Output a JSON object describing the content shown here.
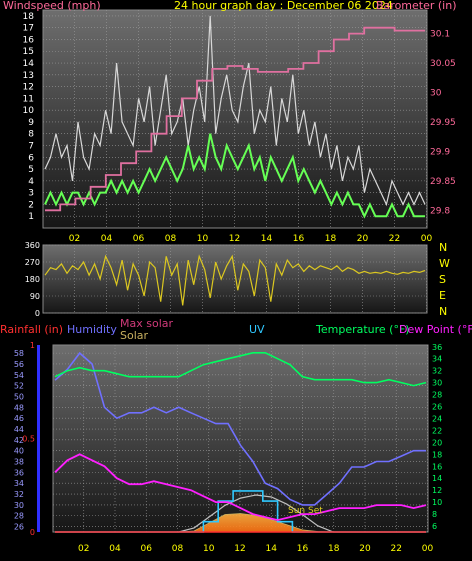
{
  "colors": {
    "background": "#000000",
    "panel_top": "#707070",
    "panel_bottom": "#1a1a1a",
    "axis_text": "#ffff00",
    "title_pink": "#ff6a9a",
    "wind_gust": "#d8d8d8",
    "wind_avg": "#66ff55",
    "barometer": "#e070a0",
    "wind_dir": "#dcc820",
    "rain": "#ff3030",
    "humidity": "#7070ff",
    "solar_max": "#d03a7a",
    "solar": "#c8b060",
    "uv": "#30c8ff",
    "temperature": "#00ff60",
    "dewpoint": "#ff20ff",
    "sun_arc": "#c0c0c0",
    "sunset_text": "#e0d020"
  },
  "top_panel": {
    "left_label": "Windspeed (mph)",
    "title": "24 hour graph day : December 06 2024",
    "right_label": "Barometer (in)"
  },
  "mid_panel": {
    "compass_labels": [
      "N",
      "W",
      "S",
      "E",
      "N"
    ]
  },
  "bottom_panel": {
    "rain_label": "Rainfall (in)",
    "humidity_label": "Humidity",
    "max_solar_label": "Max solar",
    "solar_label": "Solar",
    "uv_label": "UV",
    "temp_label": "Temperature (°F)",
    "dew_label": "Dew Point (°F)",
    "sunset_text": "Sun Set"
  },
  "chart_data": [
    {
      "type": "line",
      "x_tick_labels": [
        "02",
        "04",
        "06",
        "08",
        "10",
        "12",
        "14",
        "16",
        "18",
        "20",
        "22",
        "00"
      ],
      "y_left_ticks": [
        1,
        2,
        3,
        4,
        5,
        6,
        7,
        8,
        9,
        10,
        11,
        12,
        13,
        14,
        15,
        16,
        17,
        18
      ],
      "y_left_range": [
        0,
        18.5
      ],
      "y_right_ticks": [
        "29.8",
        "29.85",
        "29.9",
        "29.95",
        "30",
        "30.05",
        "30.1"
      ],
      "y_right_range": [
        29.77,
        30.14
      ],
      "grid": true,
      "series": [
        {
          "name": "Windspeed (mph)",
          "role": "gust",
          "axis": "left",
          "values": [
            5,
            6,
            8,
            6,
            7,
            4,
            9,
            6,
            5,
            8,
            7,
            10,
            8,
            14,
            9,
            8,
            7,
            11,
            9,
            12,
            7,
            10,
            13,
            8,
            9,
            11,
            7,
            10,
            12,
            9,
            18,
            8,
            11,
            13,
            10,
            9,
            12,
            14,
            8,
            10,
            9,
            12,
            7,
            11,
            9,
            13,
            8,
            10,
            7,
            9,
            6,
            8,
            5,
            7,
            4,
            6,
            5,
            7,
            3,
            5,
            4,
            3,
            2,
            4,
            3,
            2,
            3,
            2,
            3,
            2
          ]
        },
        {
          "name": "Windspeed (mph)",
          "role": "average",
          "axis": "left",
          "values": [
            2,
            3,
            2,
            3,
            2,
            3,
            3,
            2,
            3,
            2,
            3,
            3,
            4,
            3,
            4,
            3,
            4,
            3,
            4,
            5,
            4,
            5,
            6,
            5,
            4,
            5,
            7,
            5,
            6,
            5,
            8,
            6,
            5,
            7,
            6,
            5,
            6,
            7,
            5,
            6,
            4,
            6,
            5,
            4,
            5,
            6,
            4,
            5,
            4,
            3,
            4,
            3,
            2,
            3,
            2,
            3,
            2,
            2,
            1,
            2,
            1,
            1,
            1,
            2,
            1,
            1,
            2,
            1,
            1,
            1
          ]
        },
        {
          "name": "Barometer (in)",
          "axis": "right",
          "values": [
            29.8,
            29.81,
            29.82,
            29.84,
            29.86,
            29.88,
            29.9,
            29.93,
            29.96,
            29.99,
            30.02,
            30.04,
            30.045,
            30.04,
            30.035,
            30.035,
            30.04,
            30.05,
            30.07,
            30.09,
            30.1,
            30.11,
            30.11,
            30.105,
            30.105
          ]
        }
      ]
    },
    {
      "type": "line",
      "x_tick_labels": [
        "02",
        "04",
        "06",
        "08",
        "10",
        "12",
        "14",
        "16",
        "18",
        "20",
        "22",
        "00"
      ],
      "y_ticks": [
        0,
        90,
        180,
        270,
        360
      ],
      "y_range": [
        0,
        360
      ],
      "grid": true,
      "series": [
        {
          "name": "Wind direction",
          "values": [
            200,
            240,
            230,
            260,
            210,
            250,
            230,
            270,
            200,
            260,
            180,
            300,
            240,
            150,
            280,
            120,
            260,
            200,
            90,
            270,
            240,
            60,
            300,
            200,
            260,
            40,
            280,
            150,
            300,
            230,
            80,
            270,
            180,
            250,
            300,
            120,
            260,
            220,
            90,
            280,
            240,
            60,
            260,
            200,
            280,
            240,
            260,
            220,
            250,
            230,
            250,
            240,
            230,
            250,
            220,
            240,
            230,
            210,
            220,
            210,
            215,
            210,
            220,
            210,
            205,
            215,
            210,
            220,
            215,
            225
          ]
        }
      ]
    },
    {
      "type": "line",
      "x_tick_labels": [
        "02",
        "04",
        "06",
        "08",
        "10",
        "12",
        "14",
        "16",
        "18",
        "20",
        "22",
        "00"
      ],
      "y_left_ticks": [
        26,
        28,
        30,
        32,
        34,
        36,
        38,
        40,
        42,
        44,
        46,
        48,
        50,
        52,
        54,
        56,
        58
      ],
      "y_left_range": [
        25,
        59.5
      ],
      "y_right_ticks": [
        6,
        8,
        10,
        12,
        14,
        16,
        18,
        20,
        22,
        24,
        26,
        28,
        30,
        32,
        34,
        36
      ],
      "y_right_range": [
        5,
        36.3
      ],
      "rain_ticks": [
        "0",
        "0.5",
        "1"
      ],
      "rain_total": 0,
      "grid": true,
      "series": [
        {
          "name": "Humidity",
          "axis": "left",
          "values": [
            53,
            55,
            58,
            56,
            48,
            46,
            47,
            47,
            48,
            47,
            48,
            47,
            46,
            45,
            45,
            41,
            38,
            34,
            33,
            31,
            30,
            30,
            32,
            34,
            37,
            37,
            38,
            38,
            39,
            40,
            40
          ]
        },
        {
          "name": "Temperature (°F)",
          "axis": "right",
          "values": [
            31,
            32,
            32.5,
            32,
            32,
            31.5,
            31,
            31,
            31,
            31,
            31,
            32,
            33,
            33.5,
            34,
            34.5,
            35,
            35,
            34,
            33,
            31,
            30.5,
            30.5,
            30.5,
            30.5,
            30,
            30,
            30.5,
            30,
            29.5,
            30
          ]
        },
        {
          "name": "Dew Point (°F)",
          "axis": "right",
          "values": [
            15,
            17,
            18,
            17,
            16,
            14,
            13,
            13,
            13.5,
            13,
            12.5,
            12,
            11,
            10,
            10,
            9,
            8,
            7.5,
            7,
            7.5,
            8,
            8,
            8.5,
            9,
            9,
            9,
            9.5,
            9.5,
            9.5,
            9,
            9.5
          ]
        },
        {
          "name": "Max solar",
          "axis": "solar",
          "values": [
            0,
            0,
            0,
            0,
            0,
            0,
            0,
            0,
            0,
            40,
            150,
            260,
            330,
            360,
            340,
            270,
            170,
            60,
            0,
            0,
            0,
            0,
            0,
            0,
            0
          ]
        },
        {
          "name": "Solar",
          "axis": "solar",
          "values": [
            0,
            0,
            0,
            0,
            0,
            0,
            0,
            0,
            0,
            10,
            90,
            170,
            180,
            160,
            120,
            70,
            20,
            5,
            0,
            0,
            0,
            0,
            0,
            0,
            0
          ]
        },
        {
          "name": "UV",
          "axis": "uv",
          "values": [
            0,
            0,
            0,
            0,
            0,
            0,
            0,
            0,
            0,
            0,
            0.5,
            1.5,
            2,
            2,
            1.5,
            0.5,
            0,
            0,
            0,
            0,
            0,
            0,
            0,
            0,
            0
          ]
        },
        {
          "name": "Rainfall (in)",
          "axis": "rain",
          "values": [
            0,
            0,
            0,
            0,
            0,
            0,
            0,
            0,
            0,
            0,
            0,
            0,
            0
          ]
        }
      ]
    }
  ]
}
